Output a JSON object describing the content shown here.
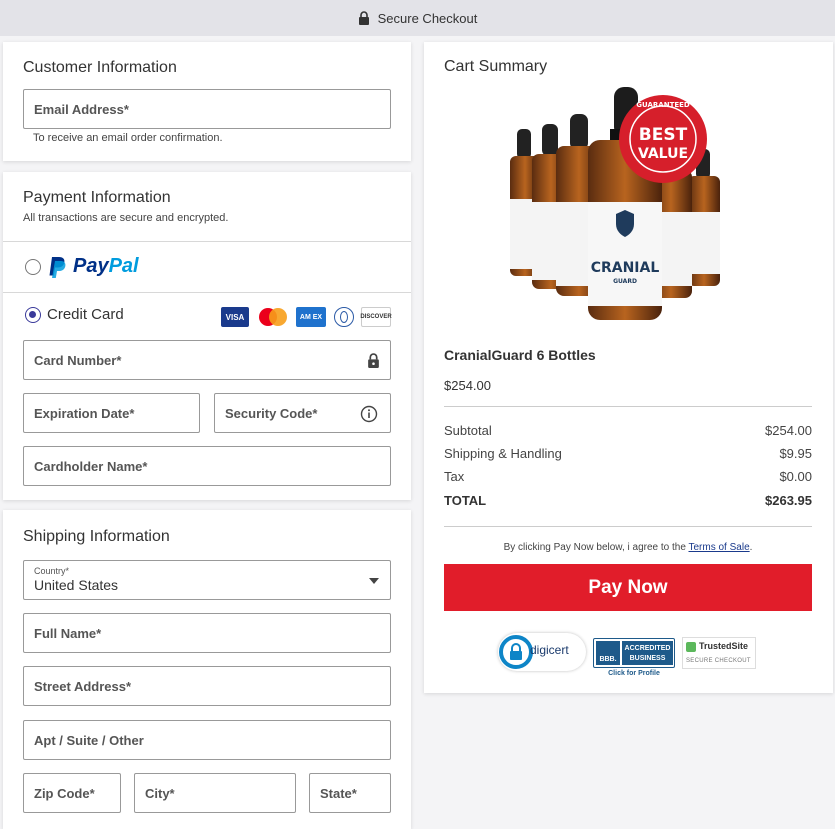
{
  "topbar": {
    "title": "Secure Checkout",
    "icon": "lock-icon"
  },
  "customer": {
    "heading": "Customer Information",
    "email_placeholder": "Email Address*",
    "email_hint": "To receive an email order confirmation."
  },
  "payment": {
    "heading": "Payment Information",
    "subheading": "All transactions are secure and encrypted.",
    "paypal_label_1": "Pay",
    "paypal_label_2": "Pal",
    "credit_label": "Credit Card",
    "card_logos": [
      "VISA",
      "",
      "AM EX",
      "",
      "DISCOVER"
    ],
    "card_number": "Card Number*",
    "expiration": "Expiration Date*",
    "security": "Security Code*",
    "cardholder": "Cardholder Name*",
    "selected": "credit"
  },
  "shipping": {
    "heading": "Shipping Information",
    "country_label": "Country*",
    "country_value": "United States",
    "full_name": "Full Name*",
    "street": "Street Address*",
    "apt": "Apt / Suite / Other",
    "zip": "Zip Code*",
    "city": "City*",
    "state": "State*"
  },
  "cart": {
    "heading": "Cart Summary",
    "product_name": "CranialGuard 6 Bottles",
    "product_price": "$254.00",
    "badge_top": "GUARANTEED",
    "badge_line1": "BEST",
    "badge_line2": "VALUE",
    "bottle_label": "CRANIAL",
    "bottle_sublabel": "GUARD",
    "subtotal_label": "Subtotal",
    "subtotal_value": "$254.00",
    "shipping_label": "Shipping & Handling",
    "shipping_value": "$9.95",
    "tax_label": "Tax",
    "tax_value": "$0.00",
    "total_label": "TOTAL",
    "total_value": "$263.95",
    "terms_prefix": "By clicking Pay Now below, i agree to the ",
    "terms_link": "Terms of Sale",
    "terms_suffix": ".",
    "pay_button": "Pay Now",
    "trust": {
      "digicert": "digicert",
      "bbb_line1": "ACCREDITED",
      "bbb_line2": "BUSINESS",
      "bbb_mark": "BBB.",
      "bbb_click": "Click for Profile",
      "trusted_name": "TrustedSite",
      "trusted_sub": "SECURE CHECKOUT"
    }
  },
  "colors": {
    "accent_red": "#e11d2a",
    "radio_blue": "#3a3a9a",
    "paypal_dark": "#003087",
    "paypal_light": "#009cde"
  }
}
